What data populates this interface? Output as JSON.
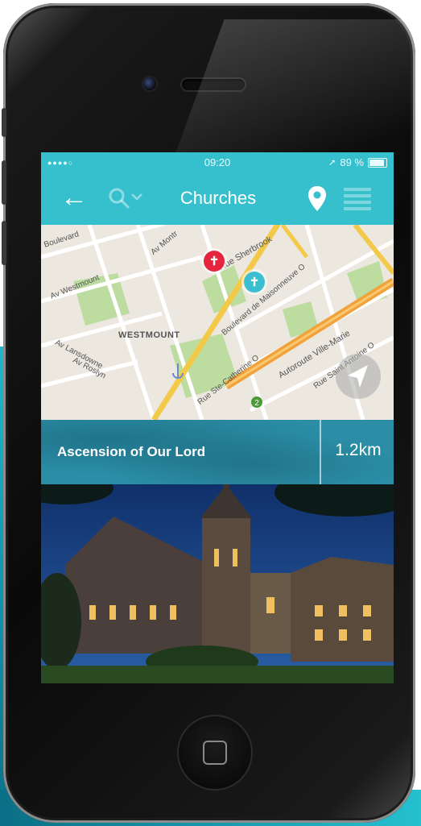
{
  "status_bar": {
    "signal": "●●●●○",
    "time": "09:20",
    "location_icon": "location-arrow-icon",
    "battery_percent": "89 %",
    "battery_level": 0.89
  },
  "nav": {
    "back_icon": "arrow-left-icon",
    "back_glyph": "←",
    "search_icon": "search-dropdown-icon",
    "title": "Churches",
    "pin_icon": "map-pin-icon",
    "list_icon": "list-icon"
  },
  "map": {
    "labels": {
      "boulevard": "Boulevard",
      "westmount_av": "Av Westmount",
      "lansdowne": "Av Lansdowne",
      "roslyn": "Av Roslyn",
      "westmount": "WESTMOUNT",
      "montreal": "Av Montr",
      "sherbrooke": "Rue Sherbrook",
      "maisonneuve": "Boulevard de Maisonneuve O",
      "ste_catherine": "Rue Ste-Catherine O",
      "ville_marie": "Autoroute Ville-Marie",
      "saint_antoine": "Rue Saint Antoine O",
      "route_badge": "2"
    },
    "pins": [
      {
        "name": "church-pin-selected",
        "glyph": "✝",
        "color": "#e4253d"
      },
      {
        "name": "church-pin",
        "glyph": "✝",
        "color": "#3bbfd0"
      }
    ]
  },
  "result": {
    "name": "Ascension of Our Lord",
    "distance": "1.2km"
  },
  "colors": {
    "accent": "#36c0cd",
    "result_bar": "#2b8ea6",
    "selected_pin": "#e4253d"
  }
}
